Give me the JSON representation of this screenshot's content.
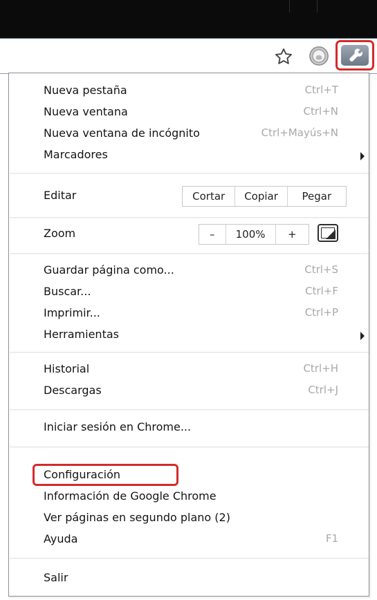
{
  "menu": {
    "sections": [
      {
        "items": [
          {
            "label": "Nueva pestaña",
            "shortcut": "Ctrl+T"
          },
          {
            "label": "Nueva ventana",
            "shortcut": "Ctrl+N"
          },
          {
            "label": "Nueva ventana de incógnito",
            "shortcut": "Ctrl+Mayús+N"
          },
          {
            "label": "Marcadores",
            "submenu": true
          }
        ]
      },
      {
        "edit": {
          "label": "Editar",
          "buttons": [
            "Cortar",
            "Copiar",
            "Pegar"
          ]
        }
      },
      {
        "zoom": {
          "label": "Zoom",
          "minus": "–",
          "value": "100%",
          "plus": "+"
        }
      },
      {
        "items": [
          {
            "label": "Guardar página como...",
            "shortcut": "Ctrl+S"
          },
          {
            "label": "Buscar...",
            "shortcut": "Ctrl+F"
          },
          {
            "label": "Imprimir...",
            "shortcut": "Ctrl+P"
          },
          {
            "label": "Herramientas",
            "submenu": true
          }
        ]
      },
      {
        "items": [
          {
            "label": "Historial",
            "shortcut": "Ctrl+H"
          },
          {
            "label": "Descargas",
            "shortcut": "Ctrl+J"
          }
        ]
      },
      {
        "items": [
          {
            "label": "Iniciar sesión en Chrome..."
          }
        ]
      },
      {
        "items": [
          {
            "label": "Configuración",
            "highlighted": true
          },
          {
            "label": "Información de Google Chrome"
          },
          {
            "label": "Ver páginas en segundo plano (2)"
          },
          {
            "label": "Ayuda",
            "shortcut": "F1"
          }
        ]
      },
      {
        "items": [
          {
            "label": "Salir"
          }
        ]
      }
    ]
  },
  "colors": {
    "highlight": "#d42a2a",
    "shortcut_text": "#a8a8a8"
  },
  "toolbar": {
    "icons": [
      "star-icon",
      "extension-icon",
      "wrench-icon"
    ]
  }
}
